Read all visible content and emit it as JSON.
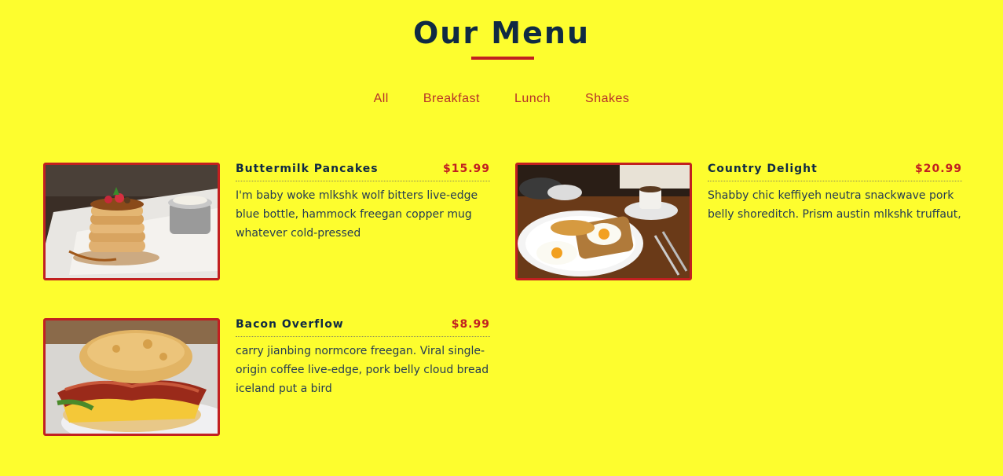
{
  "header": {
    "title": "Our Menu"
  },
  "filters": [
    "All",
    "Breakfast",
    "Lunch",
    "Shakes"
  ],
  "menu": [
    {
      "name": "Buttermilk Pancakes",
      "price": "$15.99",
      "description": "I'm baby woke mlkshk wolf bitters live-edge blue bottle, hammock freegan copper mug whatever cold-pressed",
      "image": "pancakes-photo"
    },
    {
      "name": "Country Delight",
      "price": "$20.99",
      "description": "Shabby chic keffiyeh neutra snackwave pork belly shoreditch. Prism austin mlkshk truffaut,",
      "image": "eggs-toast-photo"
    },
    {
      "name": "Bacon Overflow",
      "price": "$8.99",
      "description": "carry jianbing normcore freegan. Viral single-origin coffee live-edge, pork belly cloud bread iceland put a bird",
      "image": "bacon-sandwich-photo"
    }
  ],
  "colors": {
    "background": "#fdfd2e",
    "title": "#102a43",
    "accent": "#c12020",
    "filter_text": "#b5302a"
  }
}
